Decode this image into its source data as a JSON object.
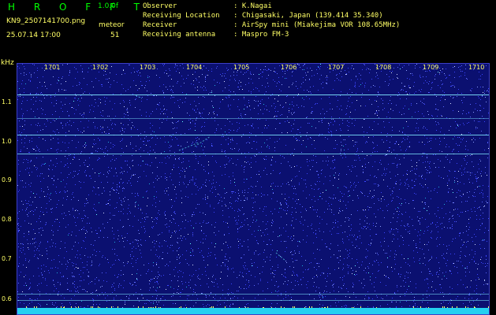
{
  "header": {
    "logo": "H R O F F T",
    "version": "1.0.0f",
    "filename": "KN9_2507141700.png",
    "timestamp": "25.07.14 17:00",
    "meteor_label": "meteor",
    "meteor_count": "51"
  },
  "info": [
    {
      "key": "Observer",
      "value": ": K.Nagai"
    },
    {
      "key": "Receiving Location",
      "value": ": Chigasaki, Japan (139.414 35.340)"
    },
    {
      "key": "Receiver",
      "value": ": AirSpy mini (Miakejima VOR 108.65MHz)"
    },
    {
      "key": "Receiving antenna",
      "value": ": Maspro FM-3"
    }
  ],
  "axis": {
    "unit": "kHz",
    "y_ticks": [
      "1.1",
      "1.0",
      "0.9",
      "0.8",
      "0.7",
      "0.6"
    ],
    "x_ticks": [
      "1701",
      "1702",
      "1703",
      "1704",
      "1705",
      "1706",
      "1707",
      "1708",
      "1709",
      "1710"
    ]
  },
  "spectrogram": {
    "background_color": "#0b1070",
    "noise_colors": [
      "#3c46ff",
      "#5e6bff",
      "#8fa0ff",
      "#d8e0ff",
      "#20b0e0",
      "#66ffff"
    ],
    "line_color": "#7fe8ff",
    "band_color": "#24d0f0"
  }
}
